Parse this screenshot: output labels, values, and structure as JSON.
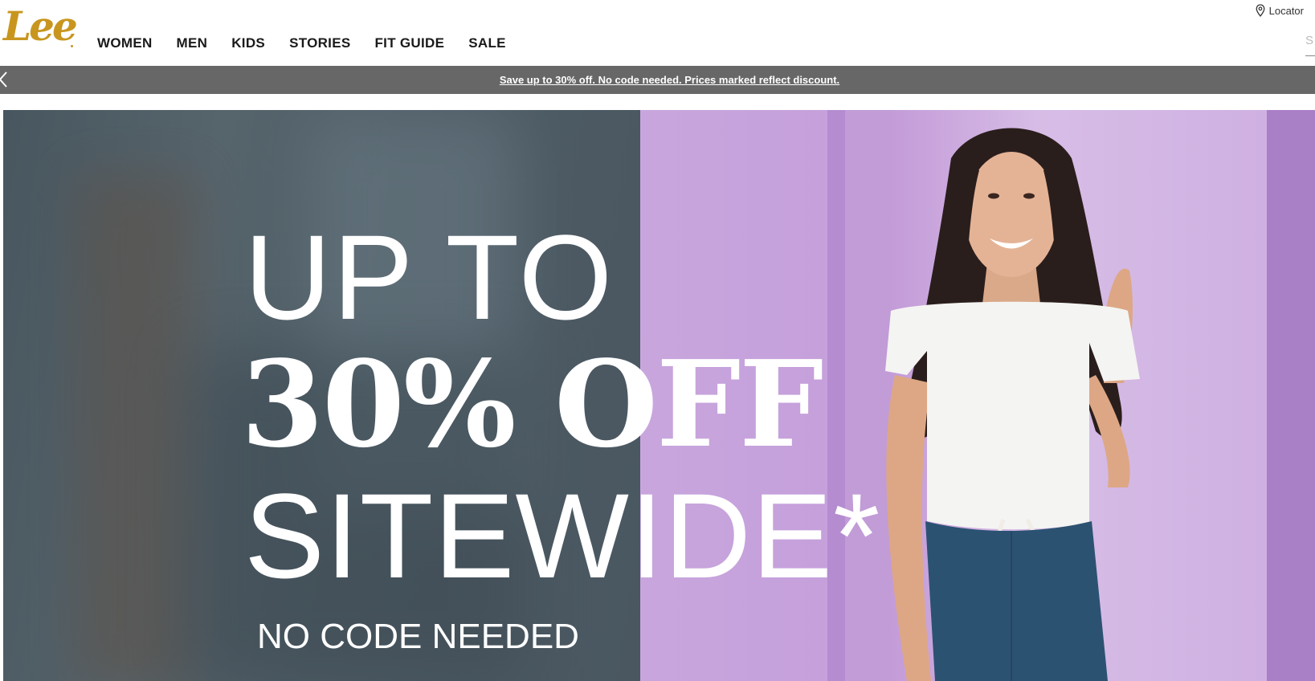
{
  "header": {
    "logo_text": "Lee",
    "nav": [
      "WOMEN",
      "MEN",
      "KIDS",
      "STORIES",
      "FIT GUIDE",
      "SALE"
    ],
    "locator_label": "Locator",
    "search_placeholder": "S"
  },
  "promo_bar": {
    "text": "Save up to 30% off. No code needed. Prices marked reflect discount."
  },
  "hero": {
    "line1": "UP TO",
    "line2": "30% OFF",
    "line3": "SITEWIDE*",
    "line4": "NO CODE NEEDED"
  },
  "colors": {
    "brand": "#c8961f",
    "promo_bar": "#676767",
    "hero_purple": "#c9a8de",
    "hero_slate": "#4b5a64"
  }
}
